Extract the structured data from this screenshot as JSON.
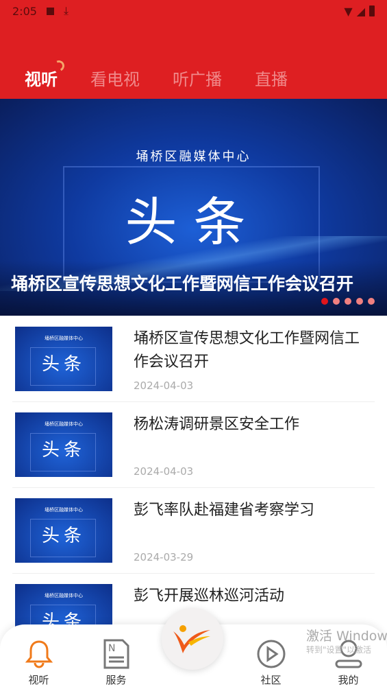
{
  "status": {
    "time": "2:05"
  },
  "tabs": [
    {
      "label": "视听",
      "active": true
    },
    {
      "label": "看电视"
    },
    {
      "label": "听广播"
    },
    {
      "label": "直播"
    }
  ],
  "banner": {
    "org": "埇桥区融媒体中心",
    "headline": "头条",
    "title": "埇桥区宣传思想文化工作暨网信工作会议召开",
    "slides": 5,
    "active_slide": 1
  },
  "news": [
    {
      "title": "埇桥区宣传思想文化工作暨网信工作会议召开",
      "date": "2024-04-03",
      "thumb_org": "埇桥区融媒体中心",
      "thumb_text": "头条"
    },
    {
      "title": "杨松涛调研景区安全工作",
      "date": "2024-04-03",
      "thumb_org": "埇桥区融媒体中心",
      "thumb_text": "头条"
    },
    {
      "title": "彭飞率队赴福建省考察学习",
      "date": "2024-03-29",
      "thumb_org": "埇桥区融媒体中心",
      "thumb_text": "头条"
    },
    {
      "title": "彭飞开展巡林巡河活动",
      "date": "",
      "thumb_org": "埇桥区融媒体中心",
      "thumb_text": "头条"
    }
  ],
  "bottom_nav": [
    {
      "label": "视听",
      "icon": "bell-icon",
      "active": true
    },
    {
      "label": "服务",
      "icon": "news-icon"
    },
    {
      "label": "社区",
      "icon": "play-icon"
    },
    {
      "label": "我的",
      "icon": "user-icon"
    }
  ],
  "watermark": {
    "line1": "激活 Windows",
    "line2": "转到\"设置\"以激活"
  },
  "colors": {
    "brand": "#de1f22",
    "active_nav": "#f07a1a"
  }
}
